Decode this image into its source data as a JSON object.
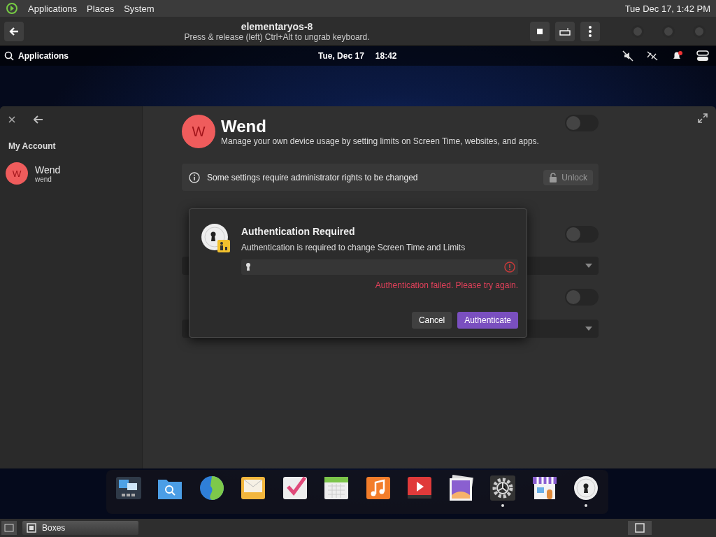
{
  "host_top_bar": {
    "menus": [
      "Applications",
      "Places",
      "System"
    ],
    "clock": "Tue Dec 17, 1:42 PM"
  },
  "vm_header": {
    "title": "elementaryos-8",
    "subtitle": "Press & release (left) Ctrl+Alt to ungrab keyboard."
  },
  "guest_panel": {
    "applications": "Applications",
    "date": "Tue, Dec 17",
    "time": "18:42",
    "notification_unread": true
  },
  "settings_window": {
    "sidebar": {
      "section": "My Account",
      "users": [
        {
          "initial": "W",
          "name": "Wend",
          "username": "wend",
          "selected": false
        }
      ]
    },
    "user": {
      "initial": "W",
      "name": "Wend",
      "description": "Manage your own device usage by setting limits on Screen Time, websites, and apps.",
      "enabled": false
    },
    "info_bar": {
      "message": "Some settings require administrator rights to be changed",
      "button": "Unlock"
    },
    "rows": [
      {
        "kind": "toggle",
        "on": false
      },
      {
        "kind": "dropdown"
      },
      {
        "kind": "toggle",
        "on": false
      },
      {
        "kind": "dropdown"
      }
    ]
  },
  "auth_dialog": {
    "title": "Authentication Required",
    "message": "Authentication is required to change Screen Time and Limits",
    "error": "Authentication failed. Please try again.",
    "buttons": [
      {
        "label": "Cancel",
        "kind": "plain"
      },
      {
        "label": "Authenticate",
        "kind": "suggested"
      }
    ]
  },
  "dock": [
    {
      "kind": "multitasking",
      "running": false
    },
    {
      "kind": "files",
      "running": false
    },
    {
      "kind": "web",
      "running": false
    },
    {
      "kind": "mail",
      "running": false
    },
    {
      "kind": "tasks",
      "running": false
    },
    {
      "kind": "calendar",
      "running": false
    },
    {
      "kind": "music",
      "running": false
    },
    {
      "kind": "videos",
      "running": false
    },
    {
      "kind": "photos",
      "running": false
    },
    {
      "kind": "settings",
      "running": true
    },
    {
      "kind": "store",
      "running": false
    },
    {
      "kind": "auth",
      "running": true
    }
  ],
  "host_taskbar": {
    "tasks": [
      {
        "label": "Boxes",
        "selected": false
      }
    ]
  }
}
